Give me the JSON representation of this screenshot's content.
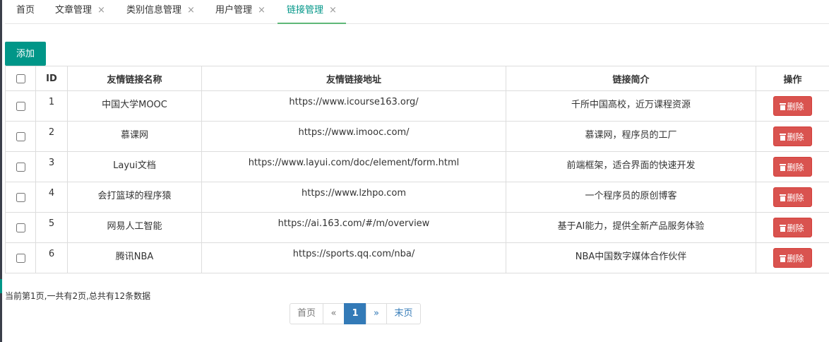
{
  "tabs": [
    {
      "label": "首页"
    },
    {
      "label": "文章管理",
      "close": "×"
    },
    {
      "label": "类别信息管理",
      "close": "×"
    },
    {
      "label": "用户管理",
      "close": "×"
    },
    {
      "label": "链接管理",
      "close": "×",
      "active": true
    }
  ],
  "toolbar": {
    "add_label": "添加"
  },
  "table": {
    "headers": [
      "ID",
      "友情链接名称",
      "友情链接地址",
      "链接简介",
      "操作"
    ],
    "delete_label": "删除",
    "rows": [
      {
        "id": "1",
        "name": "中国大学MOOC",
        "url": "https://www.icourse163.org/",
        "desc": "千所中国高校，近万课程资源"
      },
      {
        "id": "2",
        "name": "慕课网",
        "url": "https://www.imooc.com/",
        "desc": "慕课网，程序员的工厂"
      },
      {
        "id": "3",
        "name": "Layui文档",
        "url": "https://www.layui.com/doc/element/form.html",
        "desc": "前端框架，适合界面的快速开发"
      },
      {
        "id": "4",
        "name": "会打篮球的程序猿",
        "url": "https://www.lzhpo.com",
        "desc": "一个程序员的原创博客"
      },
      {
        "id": "5",
        "name": "网易人工智能",
        "url": "https://ai.163.com/#/m/overview",
        "desc": "基于AI能力，提供全新产品服务体验"
      },
      {
        "id": "6",
        "name": "腾讯NBA",
        "url": "https://sports.qq.com/nba/",
        "desc": "NBA中国数字媒体合作伙伴"
      }
    ]
  },
  "pagination": {
    "info": "当前第1页,一共有2页,总共有12条数据",
    "first": "首页",
    "prev": "«",
    "current": "1",
    "next": "»",
    "last": "末页"
  },
  "colors": {
    "accent": "#009688",
    "danger": "#d9534f",
    "page_active": "#337ab7"
  },
  "icons": {
    "tab_close": "close-icon",
    "delete": "trash-icon"
  }
}
